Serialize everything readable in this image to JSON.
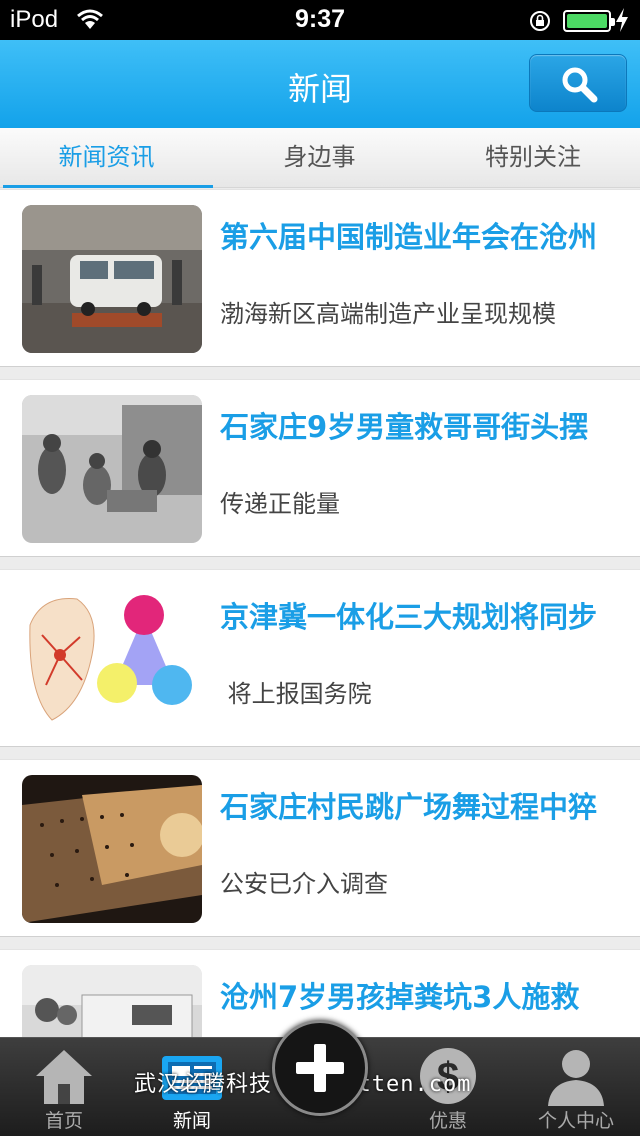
{
  "status_bar": {
    "carrier": "iPod",
    "time": "9:37",
    "battery_color": "#4cd964"
  },
  "nav": {
    "title": "新闻",
    "search_icon": "search-icon"
  },
  "tabs": [
    {
      "label": "新闻资讯",
      "active": true
    },
    {
      "label": "身边事",
      "active": false
    },
    {
      "label": "特别关注",
      "active": false
    }
  ],
  "news": [
    {
      "headline": "第六届中国制造业年会在沧州",
      "summary": "渤海新区高端制造产业呈现规模",
      "image": "factory-van-photo"
    },
    {
      "headline": "石家庄9岁男童救哥哥街头摆",
      "summary": "传递正能量",
      "image": "street-stall-photo"
    },
    {
      "headline": "京津冀一体化三大规划将同步",
      "summary": " 将上报国务院",
      "image": "region-map-diagram"
    },
    {
      "headline": "石家庄村民跳广场舞过程中猝",
      "summary": "公安已介入调查",
      "image": "dance-wall-photo"
    },
    {
      "headline": "沧州7岁男孩掉粪坑3人施救",
      "summary": "",
      "image": "ambulance-photo"
    }
  ],
  "tab_bar": {
    "items": [
      {
        "label": "首页",
        "icon": "home-icon",
        "active": false
      },
      {
        "label": "新闻",
        "icon": "news-icon",
        "active": true
      },
      {
        "label": "",
        "icon": "plus-icon",
        "active": false
      },
      {
        "label": "优惠",
        "icon": "dollar-icon",
        "active": false
      },
      {
        "label": "个人中心",
        "icon": "person-icon",
        "active": false
      }
    ],
    "watermark": "武汉必腾科技 www.btten.com"
  },
  "colors": {
    "accent": "#1a9ee6",
    "nav_bar": "#13a2ea"
  }
}
